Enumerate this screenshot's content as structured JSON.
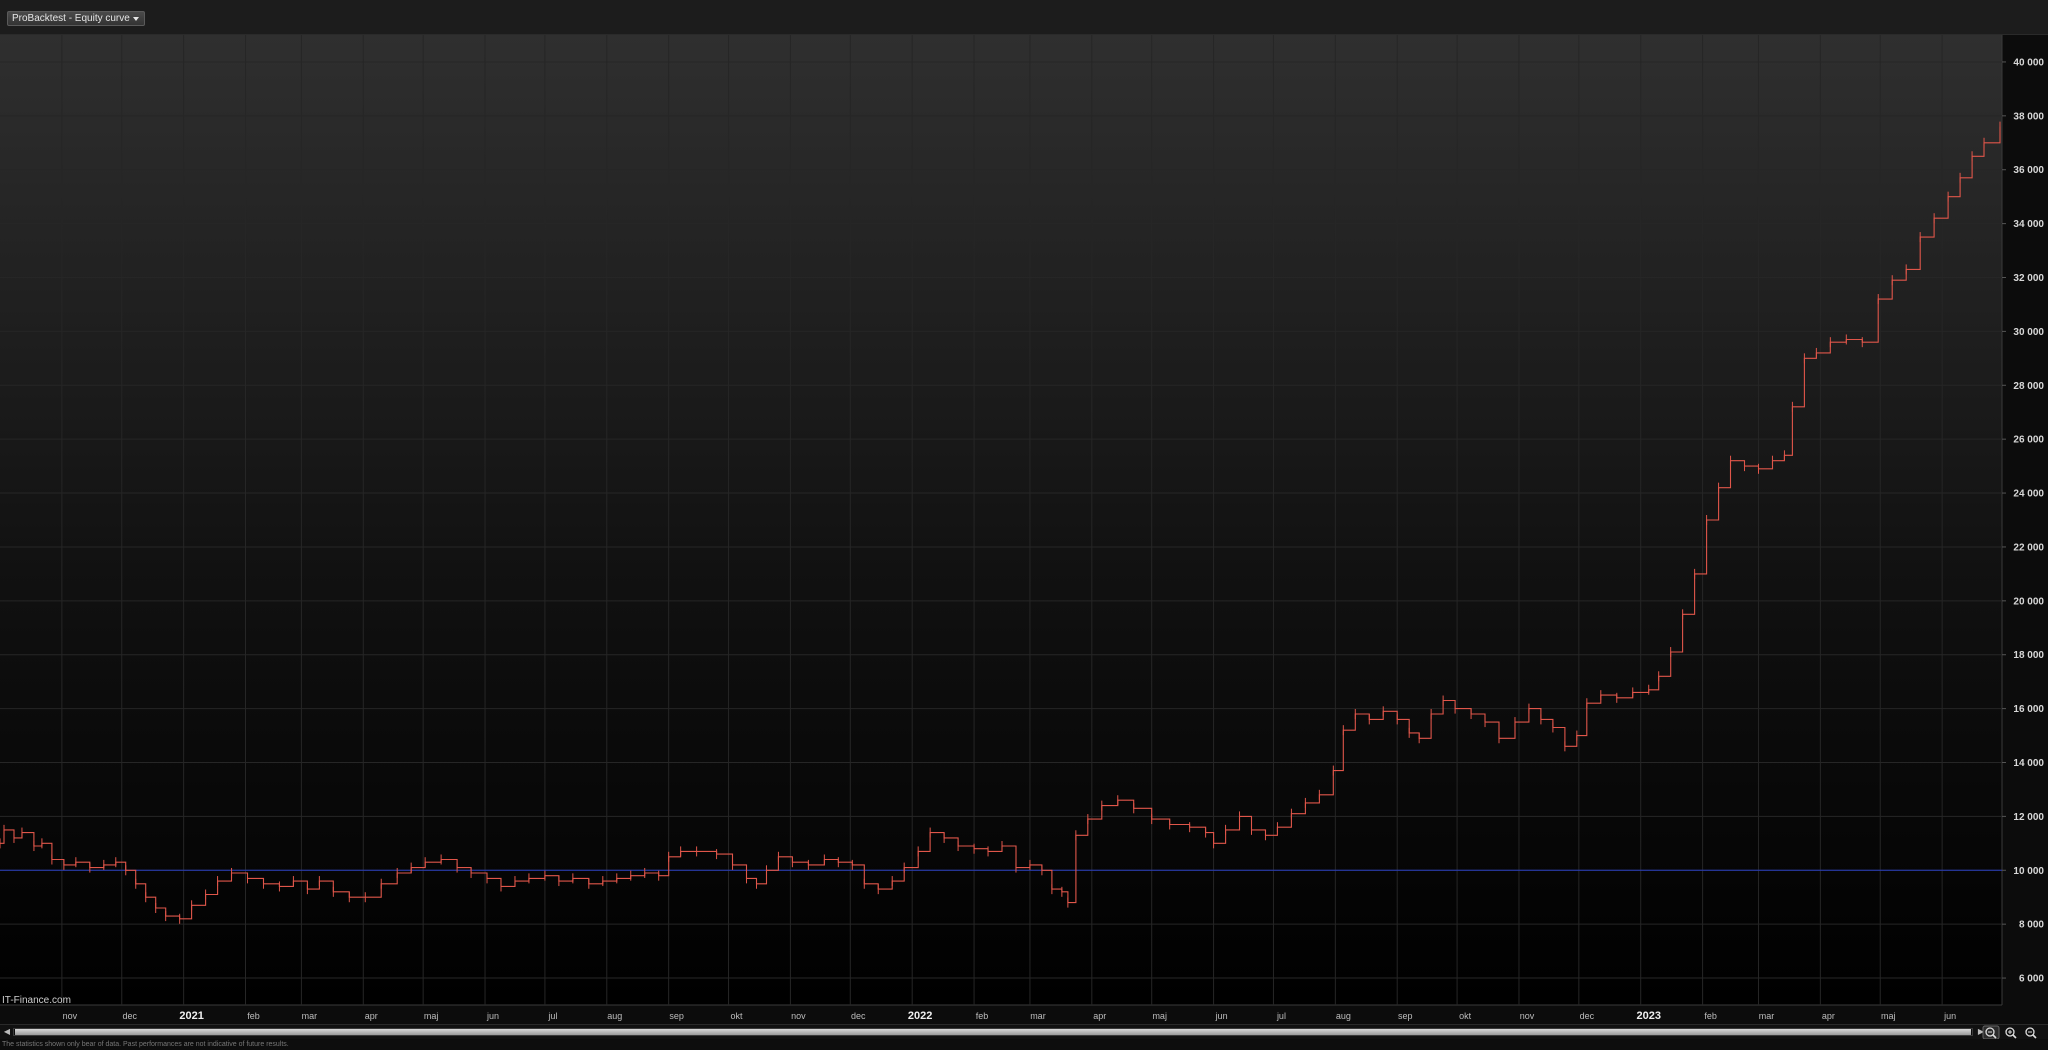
{
  "toolbar": {
    "chart_selector_label": "ProBacktest - Equity curve"
  },
  "watermark": "IT-Finance.com",
  "status": {
    "text": "The statistics shown only bear of data. Past performances are not indicative of future results."
  },
  "colors": {
    "equity_line": "#e0564a",
    "baseline": "#2a3fbf",
    "grid": "#262626",
    "axis_text": "#d8d8d8",
    "background_top": "#2f2f2f",
    "background_bottom": "#000000"
  },
  "icons": {
    "zoom_reset": "magnifier-reset-icon",
    "zoom_in": "magnifier-plus-icon",
    "zoom_out": "magnifier-minus-icon",
    "scroll_left": "arrow-left-icon",
    "scroll_right": "arrow-right-icon"
  },
  "chart_data": {
    "type": "line",
    "title": "",
    "xlabel": "",
    "ylabel": "",
    "ylim": [
      5000,
      41000
    ],
    "yticks": [
      6000,
      8000,
      10000,
      12000,
      14000,
      16000,
      18000,
      20000,
      22000,
      24000,
      26000,
      28000,
      30000,
      32000,
      34000,
      36000,
      38000,
      40000
    ],
    "ytick_labels": [
      "6 000",
      "8 000",
      "10 000",
      "12 000",
      "14 000",
      "16 000",
      "18 000",
      "20 000",
      "22 000",
      "24 000",
      "26 000",
      "28 000",
      "30 000",
      "32 000",
      "34 000",
      "36 000",
      "38 000",
      "40 000"
    ],
    "xlim": [
      "2020-10-01",
      "2023-07-01"
    ],
    "xticks": [
      {
        "date": "2020-11-01",
        "label": "nov",
        "bold": false
      },
      {
        "date": "2020-12-01",
        "label": "dec",
        "bold": false
      },
      {
        "date": "2021-01-01",
        "label": "2021",
        "bold": true
      },
      {
        "date": "2021-02-01",
        "label": "feb",
        "bold": false
      },
      {
        "date": "2021-03-01",
        "label": "mar",
        "bold": false
      },
      {
        "date": "2021-04-01",
        "label": "apr",
        "bold": false
      },
      {
        "date": "2021-05-01",
        "label": "maj",
        "bold": false
      },
      {
        "date": "2021-06-01",
        "label": "jun",
        "bold": false
      },
      {
        "date": "2021-07-01",
        "label": "jul",
        "bold": false
      },
      {
        "date": "2021-08-01",
        "label": "aug",
        "bold": false
      },
      {
        "date": "2021-09-01",
        "label": "sep",
        "bold": false
      },
      {
        "date": "2021-10-01",
        "label": "okt",
        "bold": false
      },
      {
        "date": "2021-11-01",
        "label": "nov",
        "bold": false
      },
      {
        "date": "2021-12-01",
        "label": "dec",
        "bold": false
      },
      {
        "date": "2022-01-01",
        "label": "2022",
        "bold": true
      },
      {
        "date": "2022-02-01",
        "label": "feb",
        "bold": false
      },
      {
        "date": "2022-03-01",
        "label": "mar",
        "bold": false
      },
      {
        "date": "2022-04-01",
        "label": "apr",
        "bold": false
      },
      {
        "date": "2022-05-01",
        "label": "maj",
        "bold": false
      },
      {
        "date": "2022-06-01",
        "label": "jun",
        "bold": false
      },
      {
        "date": "2022-07-01",
        "label": "jul",
        "bold": false
      },
      {
        "date": "2022-08-01",
        "label": "aug",
        "bold": false
      },
      {
        "date": "2022-09-01",
        "label": "sep",
        "bold": false
      },
      {
        "date": "2022-10-01",
        "label": "okt",
        "bold": false
      },
      {
        "date": "2022-11-01",
        "label": "nov",
        "bold": false
      },
      {
        "date": "2022-12-01",
        "label": "dec",
        "bold": false
      },
      {
        "date": "2023-01-01",
        "label": "2023",
        "bold": true
      },
      {
        "date": "2023-02-01",
        "label": "feb",
        "bold": false
      },
      {
        "date": "2023-03-01",
        "label": "mar",
        "bold": false
      },
      {
        "date": "2023-04-01",
        "label": "apr",
        "bold": false
      },
      {
        "date": "2023-05-01",
        "label": "maj",
        "bold": false
      },
      {
        "date": "2023-06-01",
        "label": "jun",
        "bold": false
      }
    ],
    "baseline": 10000,
    "grid": true,
    "series": [
      {
        "points": [
          [
            "2020-10-01",
            11000
          ],
          [
            "2020-10-03",
            11500
          ],
          [
            "2020-10-08",
            11200
          ],
          [
            "2020-10-12",
            11400
          ],
          [
            "2020-10-18",
            10900
          ],
          [
            "2020-10-22",
            11000
          ],
          [
            "2020-10-27",
            10400
          ],
          [
            "2020-11-02",
            10200
          ],
          [
            "2020-11-08",
            10300
          ],
          [
            "2020-11-15",
            10100
          ],
          [
            "2020-11-22",
            10200
          ],
          [
            "2020-11-28",
            10300
          ],
          [
            "2020-12-03",
            10000
          ],
          [
            "2020-12-08",
            9500
          ],
          [
            "2020-12-13",
            9000
          ],
          [
            "2020-12-18",
            8600
          ],
          [
            "2020-12-23",
            8300
          ],
          [
            "2020-12-30",
            8200
          ],
          [
            "2021-01-05",
            8700
          ],
          [
            "2021-01-12",
            9100
          ],
          [
            "2021-01-18",
            9600
          ],
          [
            "2021-01-25",
            9900
          ],
          [
            "2021-02-02",
            9700
          ],
          [
            "2021-02-10",
            9500
          ],
          [
            "2021-02-18",
            9400
          ],
          [
            "2021-02-25",
            9600
          ],
          [
            "2021-03-04",
            9300
          ],
          [
            "2021-03-10",
            9600
          ],
          [
            "2021-03-17",
            9200
          ],
          [
            "2021-03-25",
            9000
          ],
          [
            "2021-04-02",
            9000
          ],
          [
            "2021-04-10",
            9500
          ],
          [
            "2021-04-18",
            9900
          ],
          [
            "2021-04-25",
            10100
          ],
          [
            "2021-05-02",
            10300
          ],
          [
            "2021-05-10",
            10400
          ],
          [
            "2021-05-18",
            10100
          ],
          [
            "2021-05-25",
            9900
          ],
          [
            "2021-06-02",
            9700
          ],
          [
            "2021-06-09",
            9400
          ],
          [
            "2021-06-16",
            9600
          ],
          [
            "2021-06-23",
            9700
          ],
          [
            "2021-07-01",
            9800
          ],
          [
            "2021-07-08",
            9600
          ],
          [
            "2021-07-15",
            9700
          ],
          [
            "2021-07-23",
            9500
          ],
          [
            "2021-07-30",
            9600
          ],
          [
            "2021-08-06",
            9700
          ],
          [
            "2021-08-13",
            9800
          ],
          [
            "2021-08-20",
            9900
          ],
          [
            "2021-08-27",
            9800
          ],
          [
            "2021-09-01",
            10500
          ],
          [
            "2021-09-07",
            10700
          ],
          [
            "2021-09-15",
            10700
          ],
          [
            "2021-09-25",
            10600
          ],
          [
            "2021-10-03",
            10200
          ],
          [
            "2021-10-10",
            9700
          ],
          [
            "2021-10-15",
            9500
          ],
          [
            "2021-10-20",
            10000
          ],
          [
            "2021-10-26",
            10500
          ],
          [
            "2021-11-02",
            10300
          ],
          [
            "2021-11-10",
            10200
          ],
          [
            "2021-11-18",
            10400
          ],
          [
            "2021-11-25",
            10300
          ],
          [
            "2021-12-02",
            10200
          ],
          [
            "2021-12-08",
            9500
          ],
          [
            "2021-12-15",
            9300
          ],
          [
            "2021-12-22",
            9600
          ],
          [
            "2021-12-28",
            10100
          ],
          [
            "2022-01-04",
            10700
          ],
          [
            "2022-01-10",
            11400
          ],
          [
            "2022-01-17",
            11200
          ],
          [
            "2022-01-24",
            10900
          ],
          [
            "2022-02-01",
            10800
          ],
          [
            "2022-02-08",
            10700
          ],
          [
            "2022-02-15",
            10900
          ],
          [
            "2022-02-22",
            10100
          ],
          [
            "2022-03-01",
            10200
          ],
          [
            "2022-03-07",
            10000
          ],
          [
            "2022-03-12",
            9300
          ],
          [
            "2022-03-17",
            9200
          ],
          [
            "2022-03-20",
            8800
          ],
          [
            "2022-03-24",
            11300
          ],
          [
            "2022-03-30",
            11900
          ],
          [
            "2022-04-06",
            12400
          ],
          [
            "2022-04-14",
            12600
          ],
          [
            "2022-04-22",
            12300
          ],
          [
            "2022-05-01",
            11900
          ],
          [
            "2022-05-10",
            11700
          ],
          [
            "2022-05-20",
            11600
          ],
          [
            "2022-05-28",
            11400
          ],
          [
            "2022-06-01",
            11000
          ],
          [
            "2022-06-07",
            11500
          ],
          [
            "2022-06-14",
            12000
          ],
          [
            "2022-06-20",
            11500
          ],
          [
            "2022-06-27",
            11300
          ],
          [
            "2022-07-03",
            11600
          ],
          [
            "2022-07-10",
            12100
          ],
          [
            "2022-07-17",
            12500
          ],
          [
            "2022-07-24",
            12800
          ],
          [
            "2022-07-31",
            13700
          ],
          [
            "2022-08-05",
            15200
          ],
          [
            "2022-08-11",
            15800
          ],
          [
            "2022-08-18",
            15600
          ],
          [
            "2022-08-25",
            15900
          ],
          [
            "2022-09-01",
            15600
          ],
          [
            "2022-09-07",
            15100
          ],
          [
            "2022-09-12",
            14900
          ],
          [
            "2022-09-18",
            15800
          ],
          [
            "2022-09-24",
            16300
          ],
          [
            "2022-09-30",
            16000
          ],
          [
            "2022-10-08",
            15800
          ],
          [
            "2022-10-15",
            15500
          ],
          [
            "2022-10-22",
            14900
          ],
          [
            "2022-10-30",
            15500
          ],
          [
            "2022-11-06",
            16000
          ],
          [
            "2022-11-12",
            15600
          ],
          [
            "2022-11-18",
            15300
          ],
          [
            "2022-11-24",
            14600
          ],
          [
            "2022-11-30",
            15000
          ],
          [
            "2022-12-05",
            16200
          ],
          [
            "2022-12-12",
            16500
          ],
          [
            "2022-12-20",
            16400
          ],
          [
            "2022-12-28",
            16600
          ],
          [
            "2023-01-05",
            16700
          ],
          [
            "2023-01-10",
            17200
          ],
          [
            "2023-01-16",
            18100
          ],
          [
            "2023-01-22",
            19500
          ],
          [
            "2023-01-28",
            21000
          ],
          [
            "2023-02-03",
            23000
          ],
          [
            "2023-02-09",
            24200
          ],
          [
            "2023-02-15",
            25200
          ],
          [
            "2023-02-22",
            25000
          ],
          [
            "2023-03-01",
            24900
          ],
          [
            "2023-03-08",
            25200
          ],
          [
            "2023-03-14",
            25400
          ],
          [
            "2023-03-18",
            27200
          ],
          [
            "2023-03-24",
            29000
          ],
          [
            "2023-03-30",
            29200
          ],
          [
            "2023-04-06",
            29600
          ],
          [
            "2023-04-14",
            29700
          ],
          [
            "2023-04-22",
            29600
          ],
          [
            "2023-04-30",
            31200
          ],
          [
            "2023-05-07",
            31900
          ],
          [
            "2023-05-14",
            32300
          ],
          [
            "2023-05-21",
            33500
          ],
          [
            "2023-05-28",
            34200
          ],
          [
            "2023-06-04",
            35000
          ],
          [
            "2023-06-10",
            35700
          ],
          [
            "2023-06-16",
            36500
          ],
          [
            "2023-06-22",
            37000
          ],
          [
            "2023-06-30",
            37600
          ]
        ]
      }
    ]
  }
}
